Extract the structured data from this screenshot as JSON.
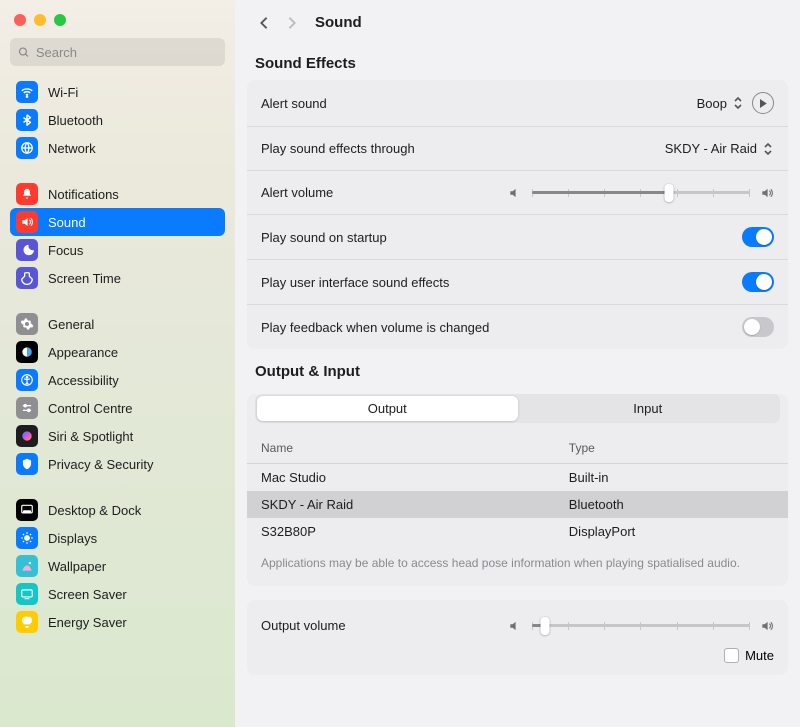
{
  "window": {
    "title": "Sound"
  },
  "search": {
    "placeholder": "Search"
  },
  "sidebar": {
    "group1": [
      {
        "label": "Wi-Fi",
        "icon": "wifi",
        "bg": "#0a7aff"
      },
      {
        "label": "Bluetooth",
        "icon": "bluetooth",
        "bg": "#0a7aff"
      },
      {
        "label": "Network",
        "icon": "network",
        "bg": "#0a7aff"
      }
    ],
    "group2": [
      {
        "label": "Notifications",
        "icon": "bell",
        "bg": "#ff3b30"
      },
      {
        "label": "Sound",
        "icon": "sound",
        "bg": "#ff3b30",
        "selected": true
      },
      {
        "label": "Focus",
        "icon": "focus",
        "bg": "#5856d6"
      },
      {
        "label": "Screen Time",
        "icon": "screentime",
        "bg": "#5856d6"
      }
    ],
    "group3": [
      {
        "label": "General",
        "icon": "general",
        "bg": "#8e8e93"
      },
      {
        "label": "Appearance",
        "icon": "appearance",
        "bg": "#000000"
      },
      {
        "label": "Accessibility",
        "icon": "accessibility",
        "bg": "#0a7aff"
      },
      {
        "label": "Control Centre",
        "icon": "control",
        "bg": "#8e8e93"
      },
      {
        "label": "Siri & Spotlight",
        "icon": "siri",
        "bg": "#1d1d1f"
      },
      {
        "label": "Privacy & Security",
        "icon": "privacy",
        "bg": "#0a7aff"
      }
    ],
    "group4": [
      {
        "label": "Desktop & Dock",
        "icon": "dock",
        "bg": "#000000"
      },
      {
        "label": "Displays",
        "icon": "displays",
        "bg": "#0a7aff"
      },
      {
        "label": "Wallpaper",
        "icon": "wallpaper",
        "bg": "#34c1d6"
      },
      {
        "label": "Screen Saver",
        "icon": "screensaver",
        "bg": "#14c6c6"
      },
      {
        "label": "Energy Saver",
        "icon": "energy",
        "bg": "#ffcc00"
      }
    ]
  },
  "sections": {
    "effects_title": "Sound Effects",
    "io_title": "Output & Input"
  },
  "soundEffects": {
    "alert_sound": {
      "label": "Alert sound",
      "value": "Boop"
    },
    "play_through": {
      "label": "Play sound effects through",
      "value": "SKDY - Air Raid"
    },
    "alert_volume": {
      "label": "Alert volume",
      "percent": 63
    },
    "startup": {
      "label": "Play sound on startup",
      "on": true
    },
    "ui_effects": {
      "label": "Play user interface sound effects",
      "on": true
    },
    "feedback": {
      "label": "Play feedback when volume is changed",
      "on": false
    }
  },
  "io": {
    "segments": [
      "Output",
      "Input"
    ],
    "active_segment": 0,
    "headers": {
      "name": "Name",
      "type": "Type"
    },
    "devices": [
      {
        "name": "Mac Studio",
        "type": "Built-in",
        "selected": false
      },
      {
        "name": "SKDY - Air Raid",
        "type": "Bluetooth",
        "selected": true
      },
      {
        "name": "S32B80P",
        "type": "DisplayPort",
        "selected": false
      }
    ],
    "note": "Applications may be able to access head pose information when playing spatialised audio."
  },
  "output_volume": {
    "label": "Output volume",
    "percent": 6,
    "mute_label": "Mute",
    "muted": false
  }
}
